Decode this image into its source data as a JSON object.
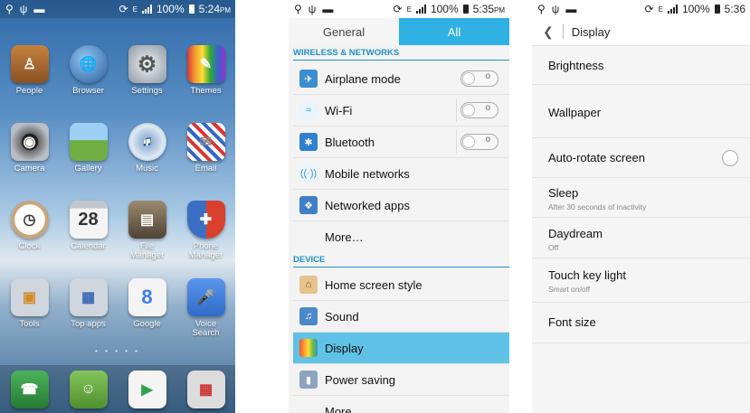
{
  "phone1": {
    "status": {
      "signal_type": "E",
      "battery": "100%",
      "time": "5:24",
      "ampm": "PM"
    },
    "apps": [
      {
        "label": "People",
        "icon": "contacts-book-icon",
        "color": "#a0602a"
      },
      {
        "label": "Browser",
        "icon": "globe-icon",
        "color": "#3a78c0"
      },
      {
        "label": "Settings",
        "icon": "gear-icon",
        "color": "#9aa3ab"
      },
      {
        "label": "Themes",
        "icon": "pencils-icon",
        "color": "#c98a3a"
      },
      {
        "label": "Camera",
        "icon": "camera-icon",
        "color": "#555a60"
      },
      {
        "label": "Gallery",
        "icon": "landscape-icon",
        "color": "#6fae43"
      },
      {
        "label": "Music",
        "icon": "cd-icon",
        "color": "#5a87b8"
      },
      {
        "label": "Email",
        "icon": "envelope-icon",
        "color": "#e8e8e8"
      },
      {
        "label": "Clock",
        "icon": "clock-icon",
        "color": "#c9a57a"
      },
      {
        "label": "Calendar",
        "icon": "calendar-icon",
        "color": "#e9e9e9"
      },
      {
        "label": "File\nManager",
        "icon": "folder-icon",
        "color": "#7a6a55"
      },
      {
        "label": "Phone\nManager",
        "icon": "shield-icon",
        "color": "#d8d8d8"
      },
      {
        "label": "Tools",
        "icon": "tools-folder-icon",
        "color": "#b9c3cc"
      },
      {
        "label": "Top apps",
        "icon": "apps-folder-icon",
        "color": "#b9c3cc"
      },
      {
        "label": "Google",
        "icon": "google-icon",
        "color": "#3f7ee8"
      },
      {
        "label": "Voice\nSearch",
        "icon": "microphone-icon",
        "color": "#4a86e0"
      }
    ],
    "calendar_day": "28",
    "dock": [
      {
        "icon": "phone-icon",
        "color": "#3c9a4a"
      },
      {
        "icon": "chat-icon",
        "color": "#6ab04c"
      },
      {
        "icon": "play-store-icon",
        "color": "#f4f4f4"
      },
      {
        "icon": "google-apps-folder-icon",
        "color": "#d9d9d9"
      }
    ]
  },
  "phone2": {
    "status": {
      "signal_type": "E",
      "battery": "100%",
      "time": "5:35",
      "ampm": "PM"
    },
    "tabs": {
      "general": "General",
      "all": "All"
    },
    "section_wireless": "WIRELESS & NETWORKS",
    "section_device": "DEVICE",
    "rows": [
      {
        "label": "Airplane mode",
        "icon": "airplane-icon",
        "color": "#3b8fd0",
        "toggle": false
      },
      {
        "label": "Wi-Fi",
        "icon": "wifi-icon",
        "color": "#2f9fd8",
        "toggle": false
      },
      {
        "label": "Bluetooth",
        "icon": "bluetooth-icon",
        "color": "#2f7fcf",
        "toggle": false
      },
      {
        "label": "Mobile networks",
        "icon": "antenna-icon",
        "color": "#3a98d8"
      },
      {
        "label": "Networked apps",
        "icon": "puzzle-icon",
        "color": "#3f7fc8"
      },
      {
        "label": "More…",
        "icon": ""
      },
      {
        "label": "Home screen style",
        "icon": "home-icon",
        "color": "#c8863a"
      },
      {
        "label": "Sound",
        "icon": "speaker-icon",
        "color": "#4a88c9"
      },
      {
        "label": "Display",
        "icon": "display-icon",
        "color": "#e2873a",
        "selected": true
      },
      {
        "label": "Power saving",
        "icon": "battery-icon",
        "color": "#5f7ba0"
      },
      {
        "label": "More",
        "icon": ""
      }
    ]
  },
  "phone3": {
    "status": {
      "signal_type": "E",
      "battery": "100%",
      "time": "5:36"
    },
    "title": "Display",
    "rows": [
      {
        "title": "Brightness"
      },
      {
        "title": "Wallpaper"
      },
      {
        "title": "Auto-rotate screen",
        "radio": true
      },
      {
        "title": "Sleep",
        "subtitle": "After 30 seconds of inactivity"
      },
      {
        "title": "Daydream",
        "subtitle": "Off"
      },
      {
        "title": "Touch key light",
        "subtitle": "Smart on/off"
      },
      {
        "title": "Font size"
      }
    ]
  }
}
